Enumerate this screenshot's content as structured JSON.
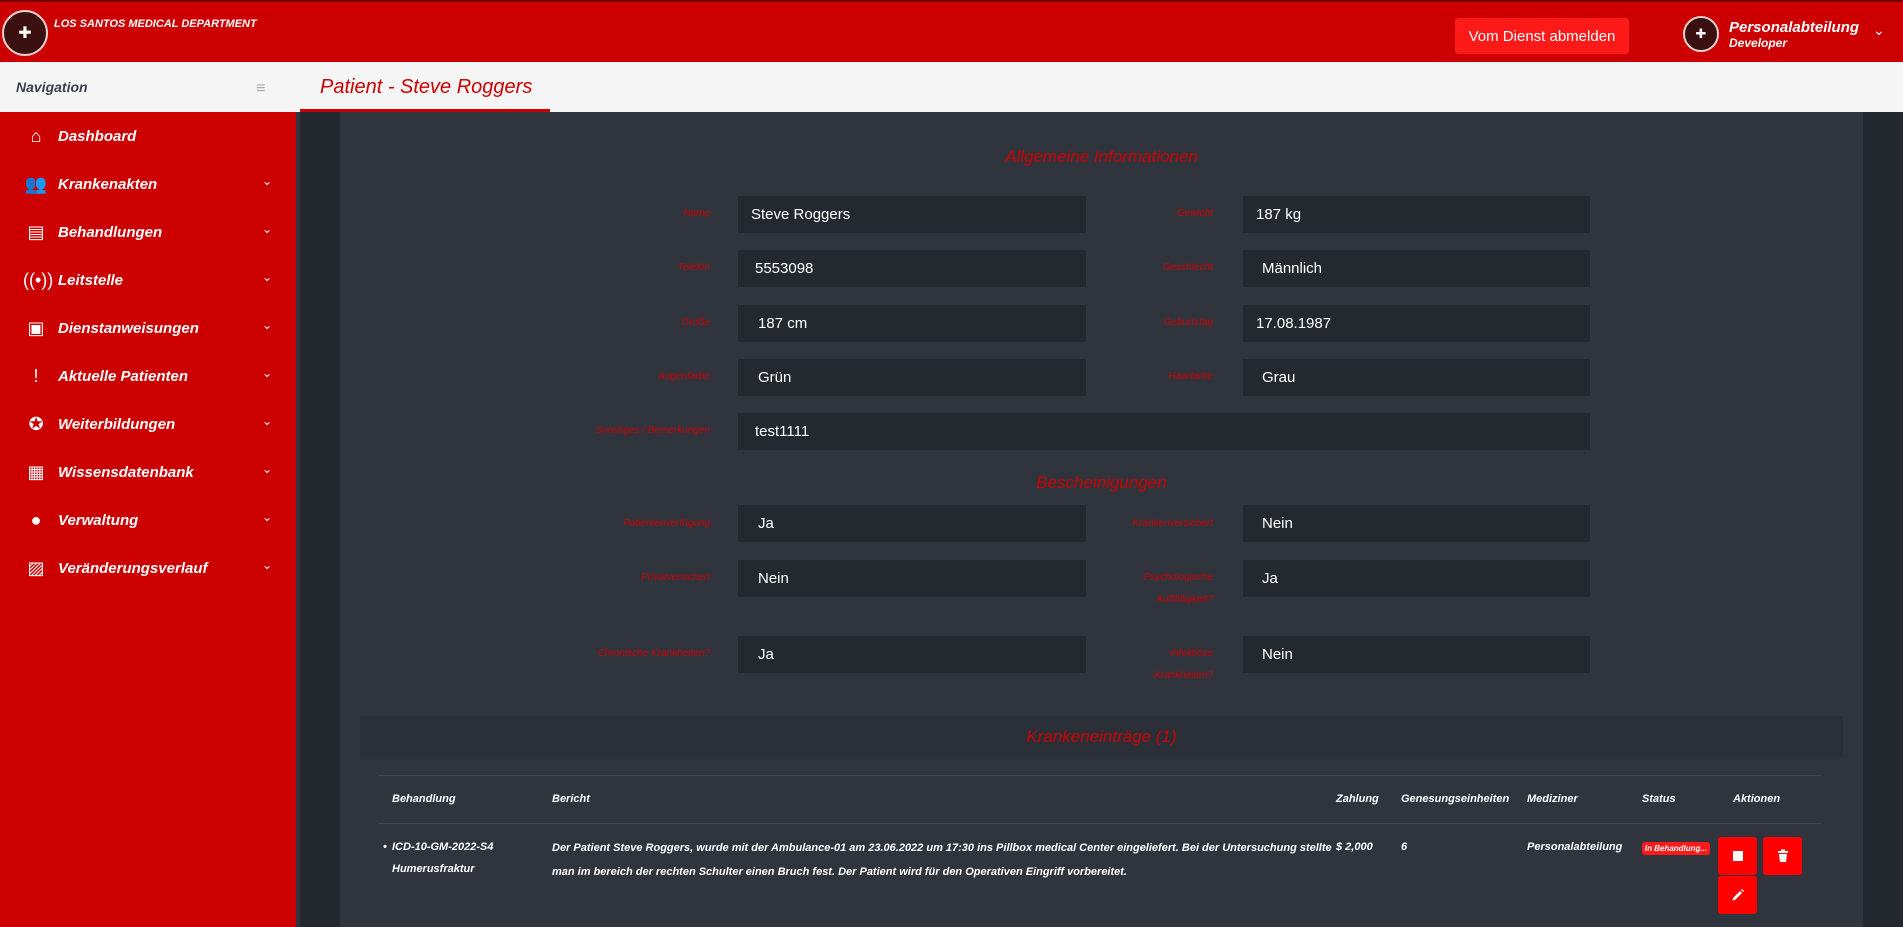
{
  "header": {
    "brand": "LOS SANTOS MEDICAL DEPARTMENT",
    "logout_label": "Vom Dienst abmelden",
    "user_name": "Personalabteilung",
    "user_role": "Developer"
  },
  "nav": {
    "title": "Navigation",
    "items": [
      {
        "label": "Dashboard"
      },
      {
        "label": "Krankenakten"
      },
      {
        "label": "Behandlungen"
      },
      {
        "label": "Leitstelle"
      },
      {
        "label": "Dienstanweisungen"
      },
      {
        "label": "Aktuelle Patienten"
      },
      {
        "label": "Weiterbildungen"
      },
      {
        "label": "Wissensdatenbank"
      },
      {
        "label": "Verwaltung"
      },
      {
        "label": "Veränderungsverlauf"
      }
    ]
  },
  "page": {
    "title": "Patient - Steve Roggers"
  },
  "general": {
    "title": "Allgemeine Informationen",
    "name_label": "Name",
    "name_value": "Steve Roggers",
    "weight_label": "Gewicht",
    "weight_value": "187 kg",
    "phone_label": "Telefon",
    "phone_value": "5553098",
    "gender_label": "Geschlecht",
    "gender_value": "Männlich",
    "height_label": "Größe",
    "height_value": "187 cm",
    "birthday_label": "Geburtstag",
    "birthday_value": "17.08.1987",
    "eyes_label": "Augenfarbe",
    "eyes_value": "Grün",
    "hair_label": "Haarfarbe",
    "hair_value": "Grau",
    "notes_label": "Sonstiges / Bemerkungen",
    "notes_value": "test1111"
  },
  "certs": {
    "title": "Bescheinigungen",
    "patient_decree_label": "Patientenverfügung",
    "patient_decree_value": "Ja",
    "health_ins_label": "Krankenversichert",
    "health_ins_value": "Nein",
    "private_ins_label": "Privatversichert",
    "private_ins_value": "Nein",
    "psych_label_1": "Psychologische",
    "psych_label_2": "Auffälligkeit?",
    "psych_value": "Ja",
    "chronic_label": "Chronische Krankheiten?",
    "chronic_value": "Ja",
    "infect_label_1": "Infektiöse",
    "infect_label_2": "Krankheiten?",
    "infect_value": "Nein"
  },
  "records": {
    "title": "Krankeneinträge (1)",
    "columns": {
      "treatment": "Behandlung",
      "report": "Bericht",
      "payment": "Zahlung",
      "recovery": "Genesungseinheiten",
      "doctor": "Mediziner",
      "status": "Status",
      "actions": "Aktionen"
    },
    "rows": [
      {
        "code": "ICD-10-GM-2022-S4",
        "treatment": "Humerusfraktur",
        "report_line1": "Der Patient Steve Roggers, wurde mit der Ambulance-01 am 23.06.2022 um 17:30 ins Pillbox medical Center eingeliefert. Bei der Untersuchung stellte",
        "report_line2": "man im bereich der rechten Schulter einen Bruch fest. Der Patient wird für den Operativen Eingriff vorbereitet.",
        "payment": "$ 2,000",
        "recovery": "6",
        "doctor": "Personalabteilung",
        "status": "In Behandlung..."
      }
    ]
  },
  "colors": {
    "primary": "#cc0000",
    "accent": "#ff0000",
    "bg": "#2f343d",
    "field": "#24282f"
  }
}
